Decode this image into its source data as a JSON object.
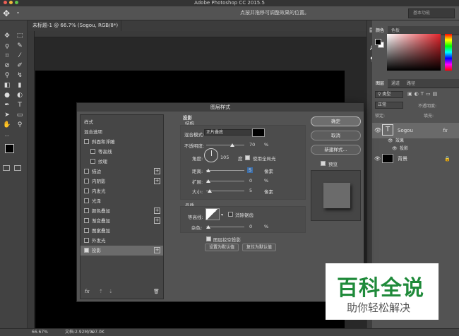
{
  "app": {
    "title": "Adobe Photoshop CC 2015.5",
    "hint": "点按并拖移可调整效果的位置。",
    "workspace": "基本功能"
  },
  "document": {
    "tab": "未标题-1 @ 66.7% (Sogou, RGB/8*) *",
    "zoom": "66.67%",
    "info": "文档:2.92M/997.0K"
  },
  "panels": {
    "color_tabs": [
      "颜色",
      "色板"
    ],
    "layer_tabs": [
      "图层",
      "通道",
      "路径"
    ],
    "filter": "类型",
    "blend": "正常",
    "opacity_label": "不透明度:",
    "lock_label": "锁定:",
    "fill_label": "填充:",
    "layers": [
      {
        "name": "Sogou",
        "fx": "fx",
        "effects": "效果",
        "effect": "投影"
      },
      {
        "name": "背景"
      }
    ]
  },
  "dialog": {
    "title": "图层样式",
    "styles_header": "样式",
    "blend_options": "混合选项",
    "items": [
      {
        "label": "斜面和浮雕",
        "checked": false,
        "plus": false
      },
      {
        "label": "等高线",
        "checked": false,
        "plus": false,
        "indent": true
      },
      {
        "label": "纹理",
        "checked": false,
        "plus": false,
        "indent": true
      },
      {
        "label": "描边",
        "checked": false,
        "plus": true
      },
      {
        "label": "内阴影",
        "checked": false,
        "plus": true
      },
      {
        "label": "内发光",
        "checked": false,
        "plus": false
      },
      {
        "label": "光泽",
        "checked": false,
        "plus": false
      },
      {
        "label": "颜色叠加",
        "checked": false,
        "plus": true
      },
      {
        "label": "渐变叠加",
        "checked": false,
        "plus": true
      },
      {
        "label": "图案叠加",
        "checked": false,
        "plus": false
      },
      {
        "label": "外发光",
        "checked": false,
        "plus": false
      },
      {
        "label": "投影",
        "checked": true,
        "plus": true,
        "selected": true
      }
    ],
    "fx": "fx",
    "section": "投影",
    "structure": "结构",
    "blend_mode_label": "混合模式:",
    "blend_mode": "正片叠底",
    "opacity_label": "不透明度:",
    "opacity": "70",
    "pct": "%",
    "angle_label": "角度:",
    "angle": "105",
    "deg": "度",
    "global_light": "使用全局光",
    "distance_label": "距离:",
    "distance": "5",
    "px": "像素",
    "spread_label": "扩展:",
    "spread": "0",
    "size_label": "大小:",
    "size": "5",
    "quality": "品质",
    "contour_label": "等高线:",
    "antialias": "消除锯齿",
    "noise_label": "杂色:",
    "noise": "0",
    "knockout": "图层挖空投影",
    "set_default": "设置为默认值",
    "reset_default": "复位为默认值",
    "ok": "确定",
    "cancel": "取消",
    "new_style": "新建样式...",
    "preview": "预览"
  },
  "watermark": {
    "title": "百科全说",
    "subtitle": "助你轻松解决"
  },
  "colors": {
    "accent": "#e3242b",
    "watermark_red": "#e02020"
  }
}
